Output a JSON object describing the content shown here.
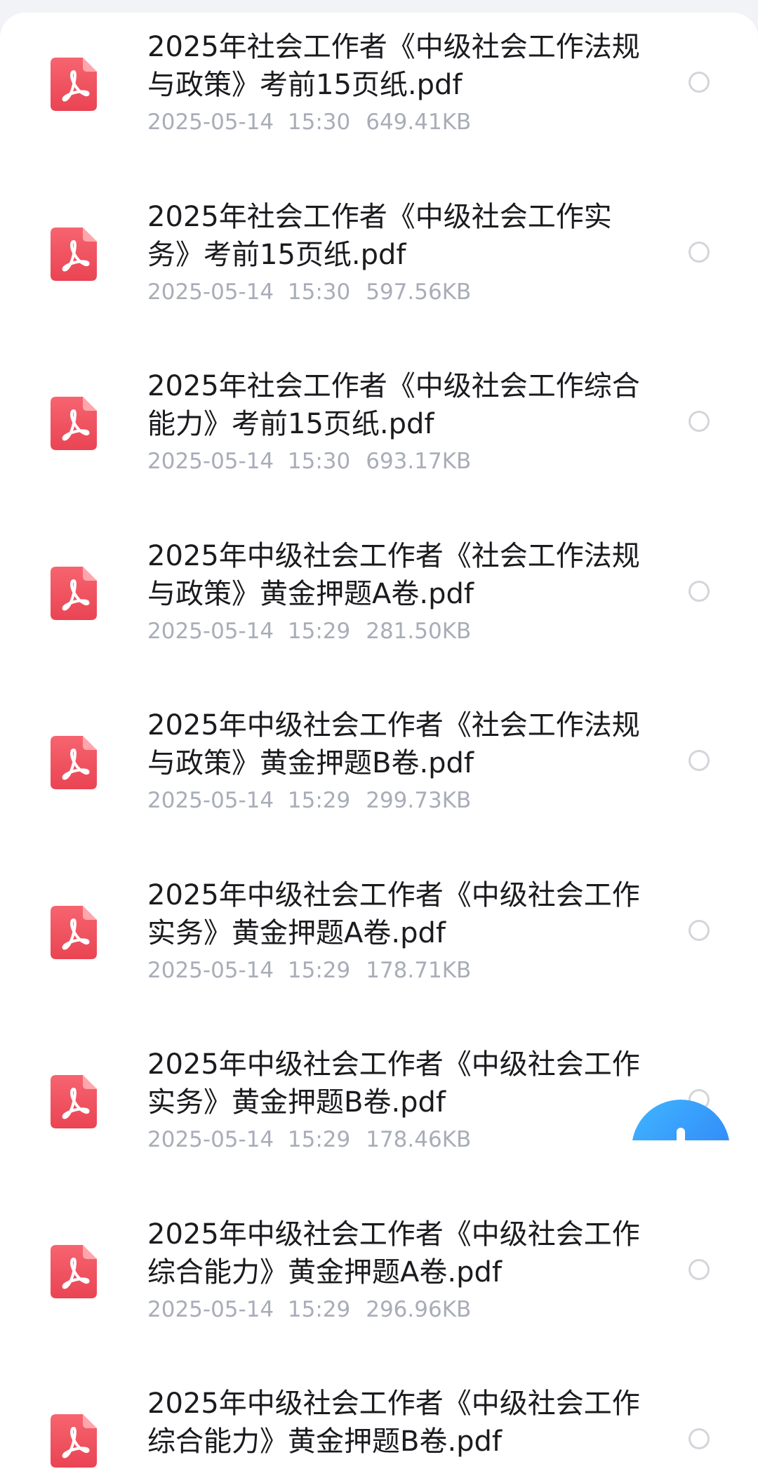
{
  "files": [
    {
      "name": "2025年社会工作者《中级社会工作法规与政策》考前15页纸.pdf",
      "date": "2025-05-14",
      "time": "15:30",
      "size": "649.41KB",
      "icon": "pdf-icon"
    },
    {
      "name": "2025年社会工作者《中级社会工作实务》考前15页纸.pdf",
      "date": "2025-05-14",
      "time": "15:30",
      "size": "597.56KB",
      "icon": "pdf-icon"
    },
    {
      "name": "2025年社会工作者《中级社会工作综合能力》考前15页纸.pdf",
      "date": "2025-05-14",
      "time": "15:30",
      "size": "693.17KB",
      "icon": "pdf-icon"
    },
    {
      "name": "2025年中级社会工作者《社会工作法规与政策》黄金押题A卷.pdf",
      "date": "2025-05-14",
      "time": "15:29",
      "size": "281.50KB",
      "icon": "pdf-icon"
    },
    {
      "name": "2025年中级社会工作者《社会工作法规与政策》黄金押题B卷.pdf",
      "date": "2025-05-14",
      "time": "15:29",
      "size": "299.73KB",
      "icon": "pdf-icon"
    },
    {
      "name": "2025年中级社会工作者《中级社会工作实务》黄金押题A卷.pdf",
      "date": "2025-05-14",
      "time": "15:29",
      "size": "178.71KB",
      "icon": "pdf-icon"
    },
    {
      "name": "2025年中级社会工作者《中级社会工作实务》黄金押题B卷.pdf",
      "date": "2025-05-14",
      "time": "15:29",
      "size": "178.46KB",
      "icon": "pdf-icon"
    },
    {
      "name": "2025年中级社会工作者《中级社会工作综合能力》黄金押题A卷.pdf",
      "date": "2025-05-14",
      "time": "15:29",
      "size": "296.96KB",
      "icon": "pdf-icon"
    },
    {
      "name": "2025年中级社会工作者《中级社会工作综合能力》黄金押题B卷.pdf",
      "date": "",
      "time": "",
      "size": "",
      "icon": "pdf-icon"
    }
  ],
  "colors": {
    "pdf_icon": "#f0525e",
    "fab": "#2f7cf6",
    "meta_text": "#a9adb8"
  },
  "fab": {
    "icon": "plus-icon"
  }
}
